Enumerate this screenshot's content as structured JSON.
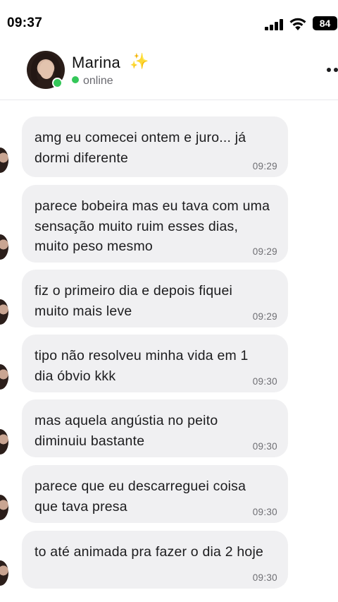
{
  "status_bar": {
    "time": "09:37",
    "battery": "84"
  },
  "header": {
    "name": "Marina",
    "emoji": "✨",
    "status": "online"
  },
  "messages": [
    {
      "text": "amg eu comecei ontem e juro... já dormi diferente",
      "time": "09:29"
    },
    {
      "text": "parece bobeira mas eu tava com uma sensação muito ruim esses dias, muito peso mesmo",
      "time": "09:29"
    },
    {
      "text": "fiz o primeiro dia e depois fiquei muito mais leve",
      "time": "09:29"
    },
    {
      "text": "tipo não resolveu minha vida em 1 dia óbvio kkk",
      "time": "09:30"
    },
    {
      "text": "mas aquela angústia no peito diminuiu bastante",
      "time": "09:30"
    },
    {
      "text": "parece que eu descarreguei coisa que tava presa",
      "time": "09:30"
    },
    {
      "text": "to até animada pra fazer o dia 2 hoje",
      "time": "09:30"
    }
  ]
}
